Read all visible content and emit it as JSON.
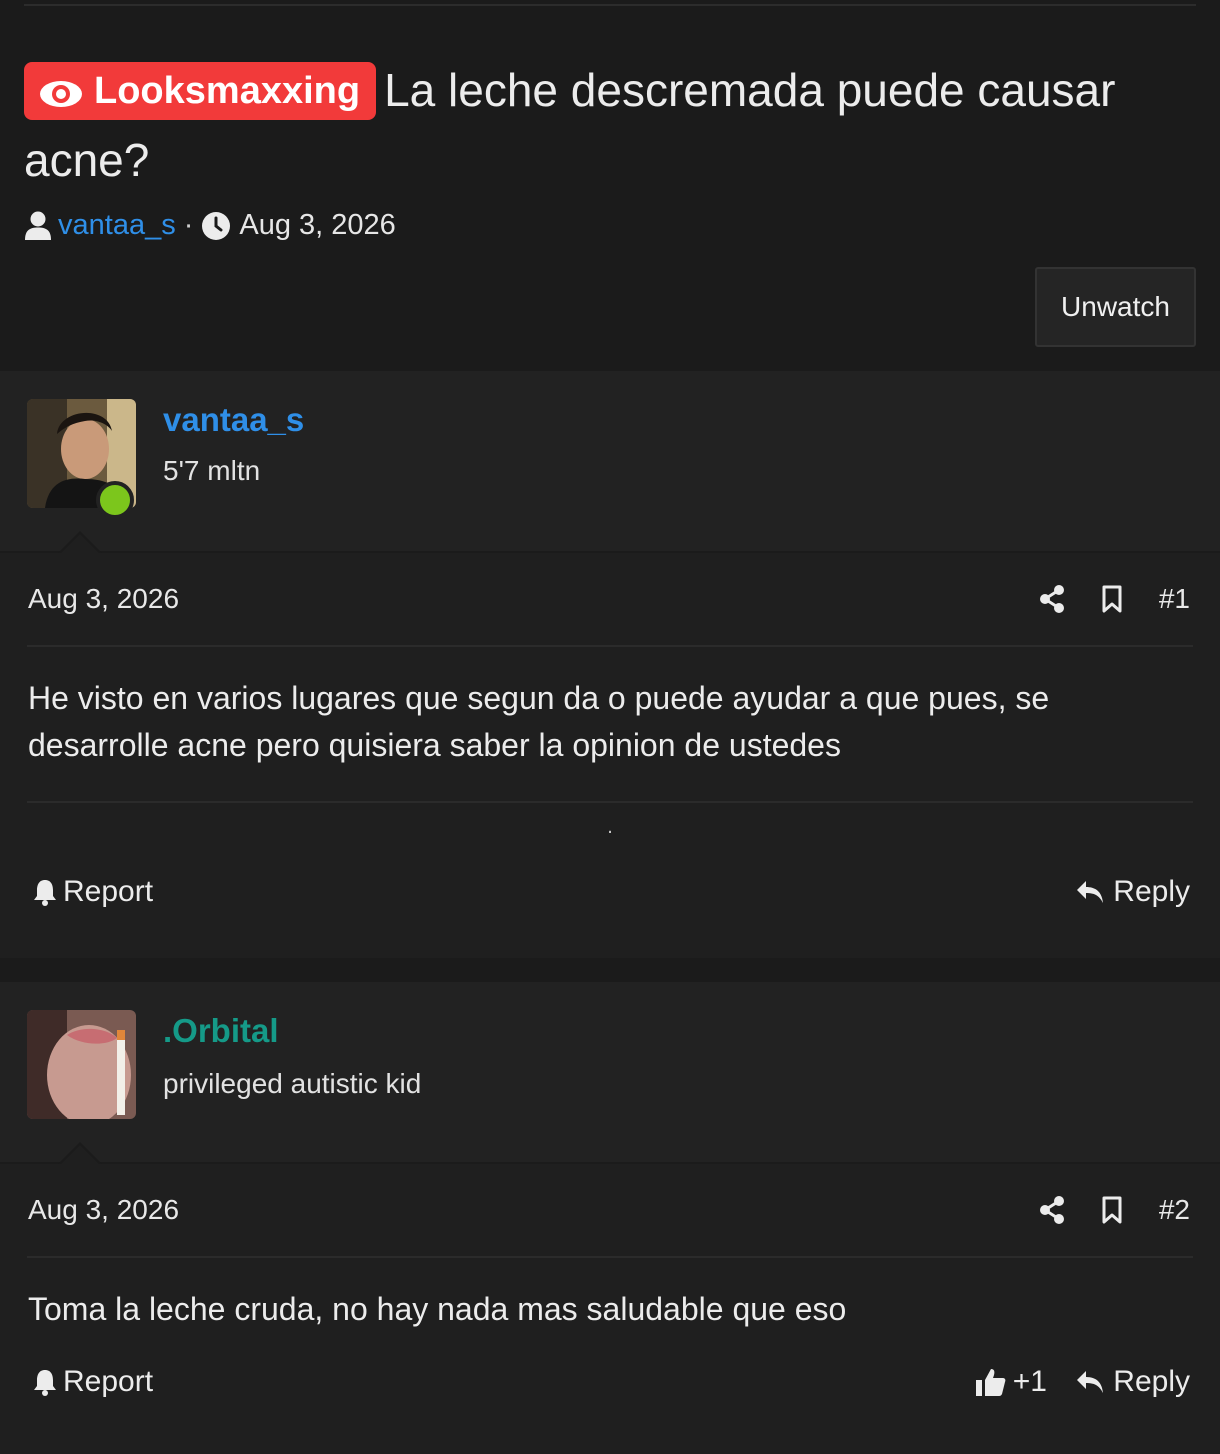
{
  "thread": {
    "prefix": "Looksmaxxing",
    "title": "La leche descremada puede causar acne?",
    "author": "vantaa_s",
    "meta_separator": "·",
    "date": "Aug 3, 2026",
    "watch_button": "Unwatch"
  },
  "posts": [
    {
      "username": "vantaa_s",
      "username_color": "#2f8fe8",
      "user_title": "5'7 mltn",
      "online": true,
      "date": "Aug 3, 2026",
      "number": "#1",
      "message": "He visto en varios lugares que segun da o puede ayudar a que pues, se desarrolle acne pero quisiera saber la opinion de ustedes",
      "signature": ".",
      "report_label": "Report",
      "reply_label": "Reply"
    },
    {
      "username": ".Orbital",
      "username_color": "#159a88",
      "user_title": "privileged autistic kid",
      "online": false,
      "date": "Aug 3, 2026",
      "number": "#2",
      "message": "Toma la leche cruda, no hay nada mas saludable que eso",
      "reaction_count": "+1",
      "report_label": "Report",
      "reply_label": "Reply"
    }
  ],
  "icons": [
    "eye-icon",
    "user-icon",
    "clock-icon",
    "share-icon",
    "bookmark-icon",
    "bell-icon",
    "reply-icon",
    "thumbs-up-icon"
  ],
  "colors": {
    "accent": "#2f8fe8",
    "prefix_bg": "#f23a3a",
    "online": "#7cc61c"
  }
}
